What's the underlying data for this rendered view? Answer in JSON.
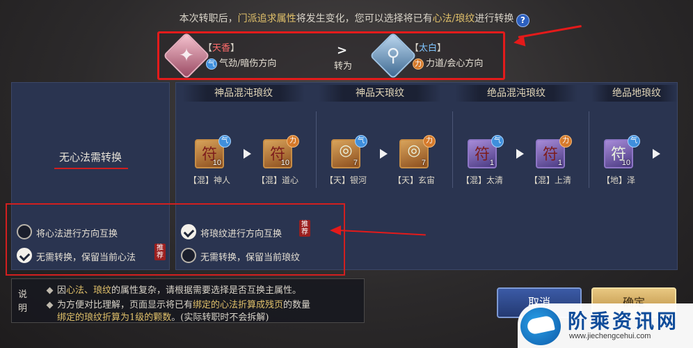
{
  "header": {
    "text_part1": "本次转职后，",
    "text_hl1": "门派追求属性",
    "text_part2": "将发生变化，您可以选择将已有",
    "text_hl2": "心法/琅纹",
    "text_part3": "进行转换",
    "help_glyph": "?"
  },
  "change": {
    "from": {
      "bracket_left": "【",
      "name": "天香",
      "bracket_right": "】",
      "badge": "气",
      "sub": "气劲/暗伤方向",
      "glyph": "✦"
    },
    "arrow": ">",
    "convert_label": "转为",
    "to": {
      "bracket_left": "【",
      "name": "太白",
      "bracket_right": "】",
      "badge": "力",
      "sub": "力道/会心方向",
      "glyph": "⚲"
    }
  },
  "left_panel": {
    "label": "无心法需转换"
  },
  "columns": [
    {
      "title": "神品混沌琅纹",
      "items": [
        {
          "label": "【混】神人",
          "count": "10",
          "badge": "气",
          "glyph": "符"
        },
        {
          "label": "【混】道心",
          "count": "10",
          "badge": "力",
          "glyph": "符"
        }
      ]
    },
    {
      "title": "神品天琅纹",
      "items": [
        {
          "label": "【天】银河",
          "count": "7",
          "badge": "气",
          "glyph": "◎"
        },
        {
          "label": "【天】玄宙",
          "count": "7",
          "badge": "力",
          "glyph": "◎"
        }
      ]
    },
    {
      "title": "绝品混沌琅纹",
      "items": [
        {
          "label": "【混】太清",
          "count": "1",
          "badge": "气",
          "glyph": "符"
        },
        {
          "label": "【混】上清",
          "count": "1",
          "badge": "力",
          "glyph": "符"
        }
      ]
    },
    {
      "title": "绝品地琅纹",
      "items": [
        {
          "label": "【地】泽",
          "count": "10",
          "badge": "气",
          "glyph": "符"
        }
      ]
    }
  ],
  "options": {
    "left": [
      {
        "text": "将心法进行方向互换",
        "checked": false
      },
      {
        "text": "无需转换，保留当前心法",
        "checked": true,
        "tag": "推荐"
      }
    ],
    "right": [
      {
        "text": "将琅纹进行方向互换",
        "checked": true,
        "tag": "推荐"
      },
      {
        "text": "无需转换，保留当前琅纹",
        "checked": false
      }
    ]
  },
  "notes": {
    "label": "说明",
    "line1_part1": "因",
    "line1_hl": "心法、琅纹",
    "line1_part2": "的属性复杂，请根据需要选择是否互换主属性。",
    "line2_part1": "为方便对比理解，页面显示将已有",
    "line2_hl": "绑定的心法折算成残页",
    "line2_part2": "的数量",
    "line3_part1": "",
    "line3_hl": "绑定的琅纹折算为1级的颗数",
    "line3_part2": "。(实际转职时不会拆解)"
  },
  "buttons": {
    "cancel": "取消",
    "ok": "确定"
  },
  "watermark": {
    "title": "阶乘资讯网",
    "url": "www.jiechengcehui.com"
  },
  "colors": {
    "highlight_box": "#e31b1b",
    "gold_text": "#e0c06a",
    "panel_bg": "#2a3450"
  }
}
